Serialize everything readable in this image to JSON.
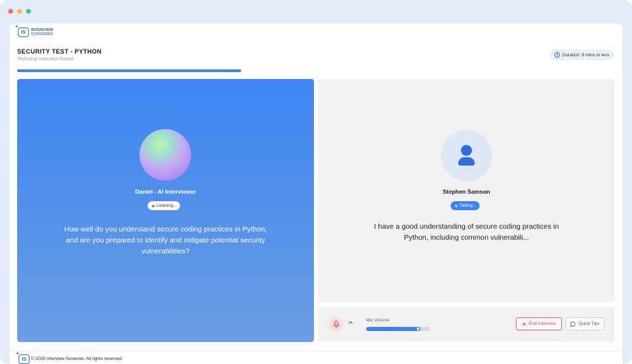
{
  "brand": {
    "line1": "INTERVIEW",
    "line2": "SCREENER",
    "mark": "IS"
  },
  "header": {
    "title": "SECURITY TEST - PYTHON",
    "subtitle": "Technical Interview Round",
    "duration": "Duration: 8 mins or less",
    "progress_fraction": 0.37
  },
  "ai": {
    "name": "Daniel - AI Interviewer",
    "status": "Listening...",
    "question": "How well do you understand secure coding practices in Python, and are you prepared to identify and mitigate potential security vulnerabilities?"
  },
  "candidate": {
    "name": "Stephen Samson",
    "status": "Talking...",
    "answer": "I have a good understanding of secure coding practices in Python, including common vulnerabili..."
  },
  "controls": {
    "mic_volume_label": "Mic Volume",
    "mic_volume_level": 0.85,
    "end_label": "End Interview",
    "tips_label": "Quick Tips"
  },
  "footer": {
    "text": "© 2026 Interview Screener. All rights reserved."
  },
  "colors": {
    "accent": "#3b82f6",
    "danger": "#d84c4c",
    "ai_panel_top": "#3d86f3",
    "ai_panel_bottom": "#6b9ee2"
  },
  "icons": {
    "duration": "clock-icon",
    "mic": "microphone-icon",
    "caret": "chevron-up-icon",
    "end": "close-icon",
    "tips": "chat-bubble-icon",
    "candidate": "user-icon"
  }
}
